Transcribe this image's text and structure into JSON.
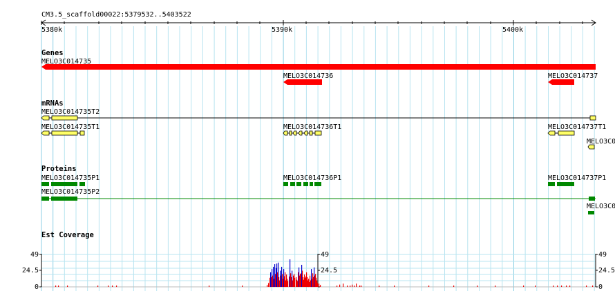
{
  "ruler": {
    "title": "CM3.5_scaffold00022:5379532..5403522",
    "ticks": [
      "5380k",
      "5390k",
      "5400k"
    ]
  },
  "tracks": {
    "genes": {
      "title": "Genes",
      "items": [
        "MELO3C014735",
        "MELO3C014736",
        "MELO3C014737"
      ]
    },
    "mrnas": {
      "title": "mRNAs",
      "items": [
        "MELO3C014735T2",
        "MELO3C014735T1",
        "MELO3C014736T1",
        "MELO3C014737T1",
        "MELO3C0"
      ]
    },
    "proteins": {
      "title": "Proteins",
      "items": [
        "MELO3C014735P1",
        "MELO3C014735P2",
        "MELO3C014736P1",
        "MELO3C014737P1",
        "MELO3C0"
      ]
    },
    "est": {
      "title": "Est Coverage",
      "scale": [
        "49",
        "24.5",
        "0"
      ]
    }
  },
  "colors": {
    "gene": "#ff0000",
    "mrna": "#ffff66",
    "protein": "#008800",
    "grid": "#b8e4f0",
    "est_red": "#ee0000",
    "est_blue": "#0000cc"
  }
}
